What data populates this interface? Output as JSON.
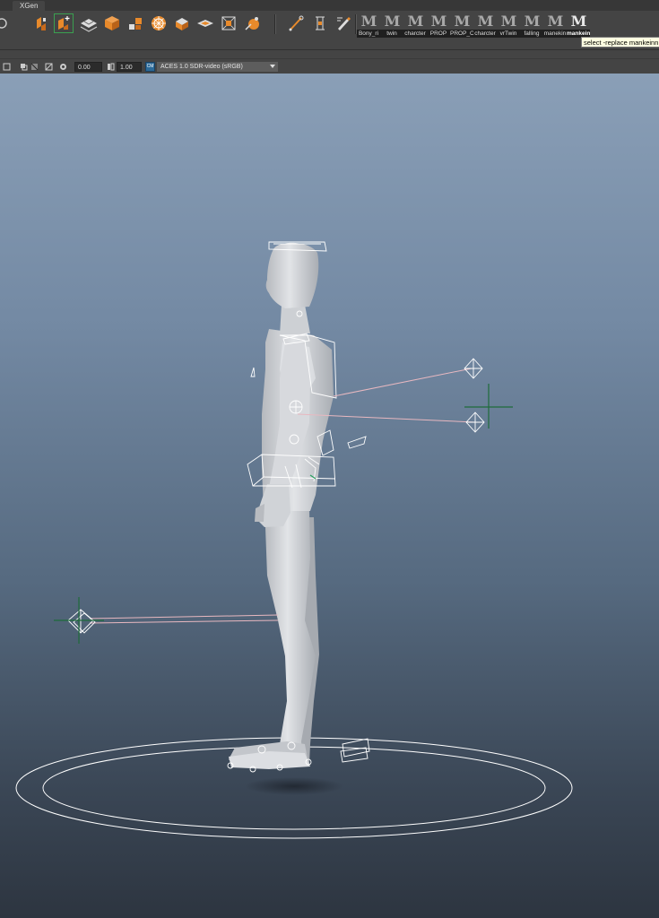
{
  "tabs": {
    "active": "XGen"
  },
  "shelf": {
    "tools": [
      {
        "name": "curve-tool-icon"
      },
      {
        "name": "create-joint-icon"
      },
      {
        "name": "move-component-icon"
      },
      {
        "name": "cube-icon"
      },
      {
        "name": "blocks-icon"
      },
      {
        "name": "wheel-icon"
      },
      {
        "name": "prism-icon"
      },
      {
        "name": "layers-icon"
      },
      {
        "name": "frame-box-icon"
      },
      {
        "name": "bone-link-icon"
      },
      {
        "name": "pen-draw-icon"
      },
      {
        "name": "bracket-frame-icon"
      },
      {
        "name": "edit-pencil-icon"
      }
    ],
    "scripts": [
      {
        "label": "Bony_ri"
      },
      {
        "label": "twin"
      },
      {
        "label": "charcter"
      },
      {
        "label": "PROP"
      },
      {
        "label": "PROP_C"
      },
      {
        "label": "charcter"
      },
      {
        "label": "vrTwin"
      },
      {
        "label": "falling"
      },
      {
        "label": "manekin"
      },
      {
        "label": "mankein"
      }
    ],
    "tooltip": "select -replace mankeinn"
  },
  "panel_toolbar": {
    "exposure": "0.00",
    "gamma": "1.00",
    "color_space": "ACES 1.0 SDR-video (sRGB)"
  },
  "colors": {
    "accent_orange": "#e88a2b",
    "rig_wire": "#ffffff",
    "pole_vector_line": "#e8b8c0",
    "locator_green": "#1e6b3a",
    "figure_gray": "#d4d6da"
  }
}
